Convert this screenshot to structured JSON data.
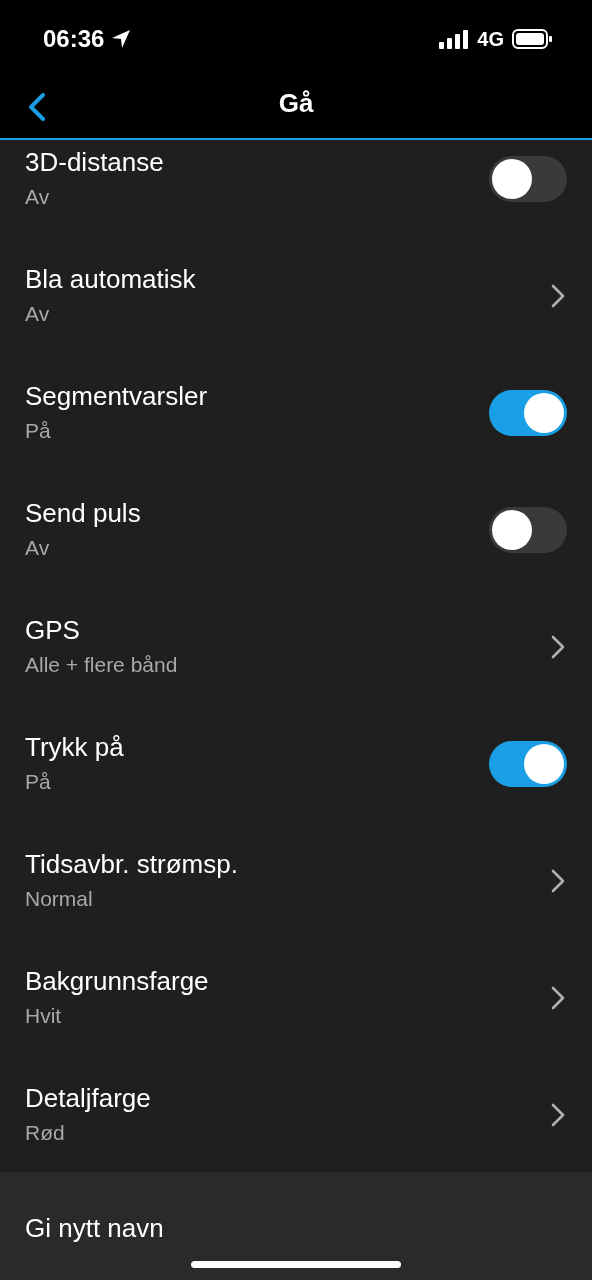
{
  "status_bar": {
    "time": "06:36",
    "network": "4G"
  },
  "nav": {
    "title": "Gå"
  },
  "settings": [
    {
      "kind": "toggle",
      "title": "3D-distanse",
      "value": "Av",
      "on": false
    },
    {
      "kind": "link",
      "title": "Bla automatisk",
      "value": "Av"
    },
    {
      "kind": "toggle",
      "title": "Segmentvarsler",
      "value": "På",
      "on": true
    },
    {
      "kind": "toggle",
      "title": "Send puls",
      "value": "Av",
      "on": false
    },
    {
      "kind": "link",
      "title": "GPS",
      "value": "Alle + flere bånd"
    },
    {
      "kind": "toggle",
      "title": "Trykk på",
      "value": "På",
      "on": true
    },
    {
      "kind": "link",
      "title": "Tidsavbr. strømsp.",
      "value": "Normal"
    },
    {
      "kind": "link",
      "title": "Bakgrunnsfarge",
      "value": "Hvit"
    },
    {
      "kind": "link",
      "title": "Detaljfarge",
      "value": "Rød"
    }
  ],
  "actions": [
    {
      "label": "Gi nytt navn"
    }
  ]
}
